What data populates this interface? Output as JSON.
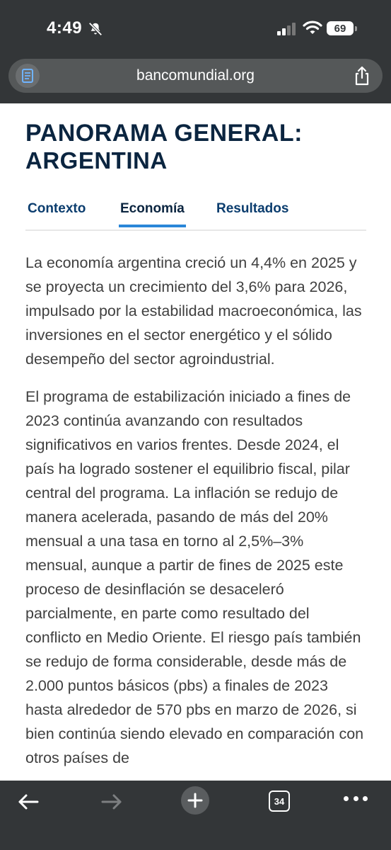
{
  "status_bar": {
    "time": "4:49",
    "battery": "69",
    "icons": [
      "bell-slash-icon",
      "signal-icon",
      "wifi-icon",
      "battery-icon"
    ]
  },
  "browser": {
    "url": "bancomundial.org",
    "reader_icon": "reader-mode-icon",
    "share_icon": "share-icon",
    "toolbar": {
      "back_icon": "back-arrow-icon",
      "forward_icon": "forward-arrow-icon",
      "new_tab_icon": "plus-icon",
      "tab_count": "34",
      "more_icon": "more-dots-icon"
    }
  },
  "page": {
    "title": "PANORAMA GENERAL:",
    "subtitle": "ARGENTINA",
    "tabs": [
      {
        "label": "Contexto",
        "active": false
      },
      {
        "label": "Economía",
        "active": true
      },
      {
        "label": "Resultados",
        "active": false
      }
    ],
    "paragraphs": [
      "La economía argentina creció un 4,4% en 2025 y se proyecta un crecimiento del 3,6% para 2026, impulsado por la estabilidad macroeconómica, las inversiones en el sector energético y el sólido desempeño del sector agroindustrial.",
      "El programa de estabilización iniciado a fines de 2023 continúa avanzando con resultados significativos en varios frentes. Desde 2024, el país ha logrado sostener el equilibrio fiscal, pilar central del programa. La inflación se redujo de manera acelerada, pasando de más del 20% mensual a una tasa en torno al 2,5%–3% mensual, aunque a partir de fines de 2025 este proceso de desinflación se desaceleró parcialmente, en parte como resultado del conflicto en Medio Oriente. El riesgo país también se redujo de forma considerable, desde más de 2.000 puntos básicos (pbs) a finales de 2023 hasta alrededor de 570 pbs en marzo de 2026, si bien continúa siendo elevado en comparación con otros países de"
    ]
  },
  "colors": {
    "title": "#0b2540",
    "tab_text": "#0b3d6e",
    "tab_active_underline": "#2a86d8",
    "body_text": "#404040",
    "chrome": "#333638"
  }
}
